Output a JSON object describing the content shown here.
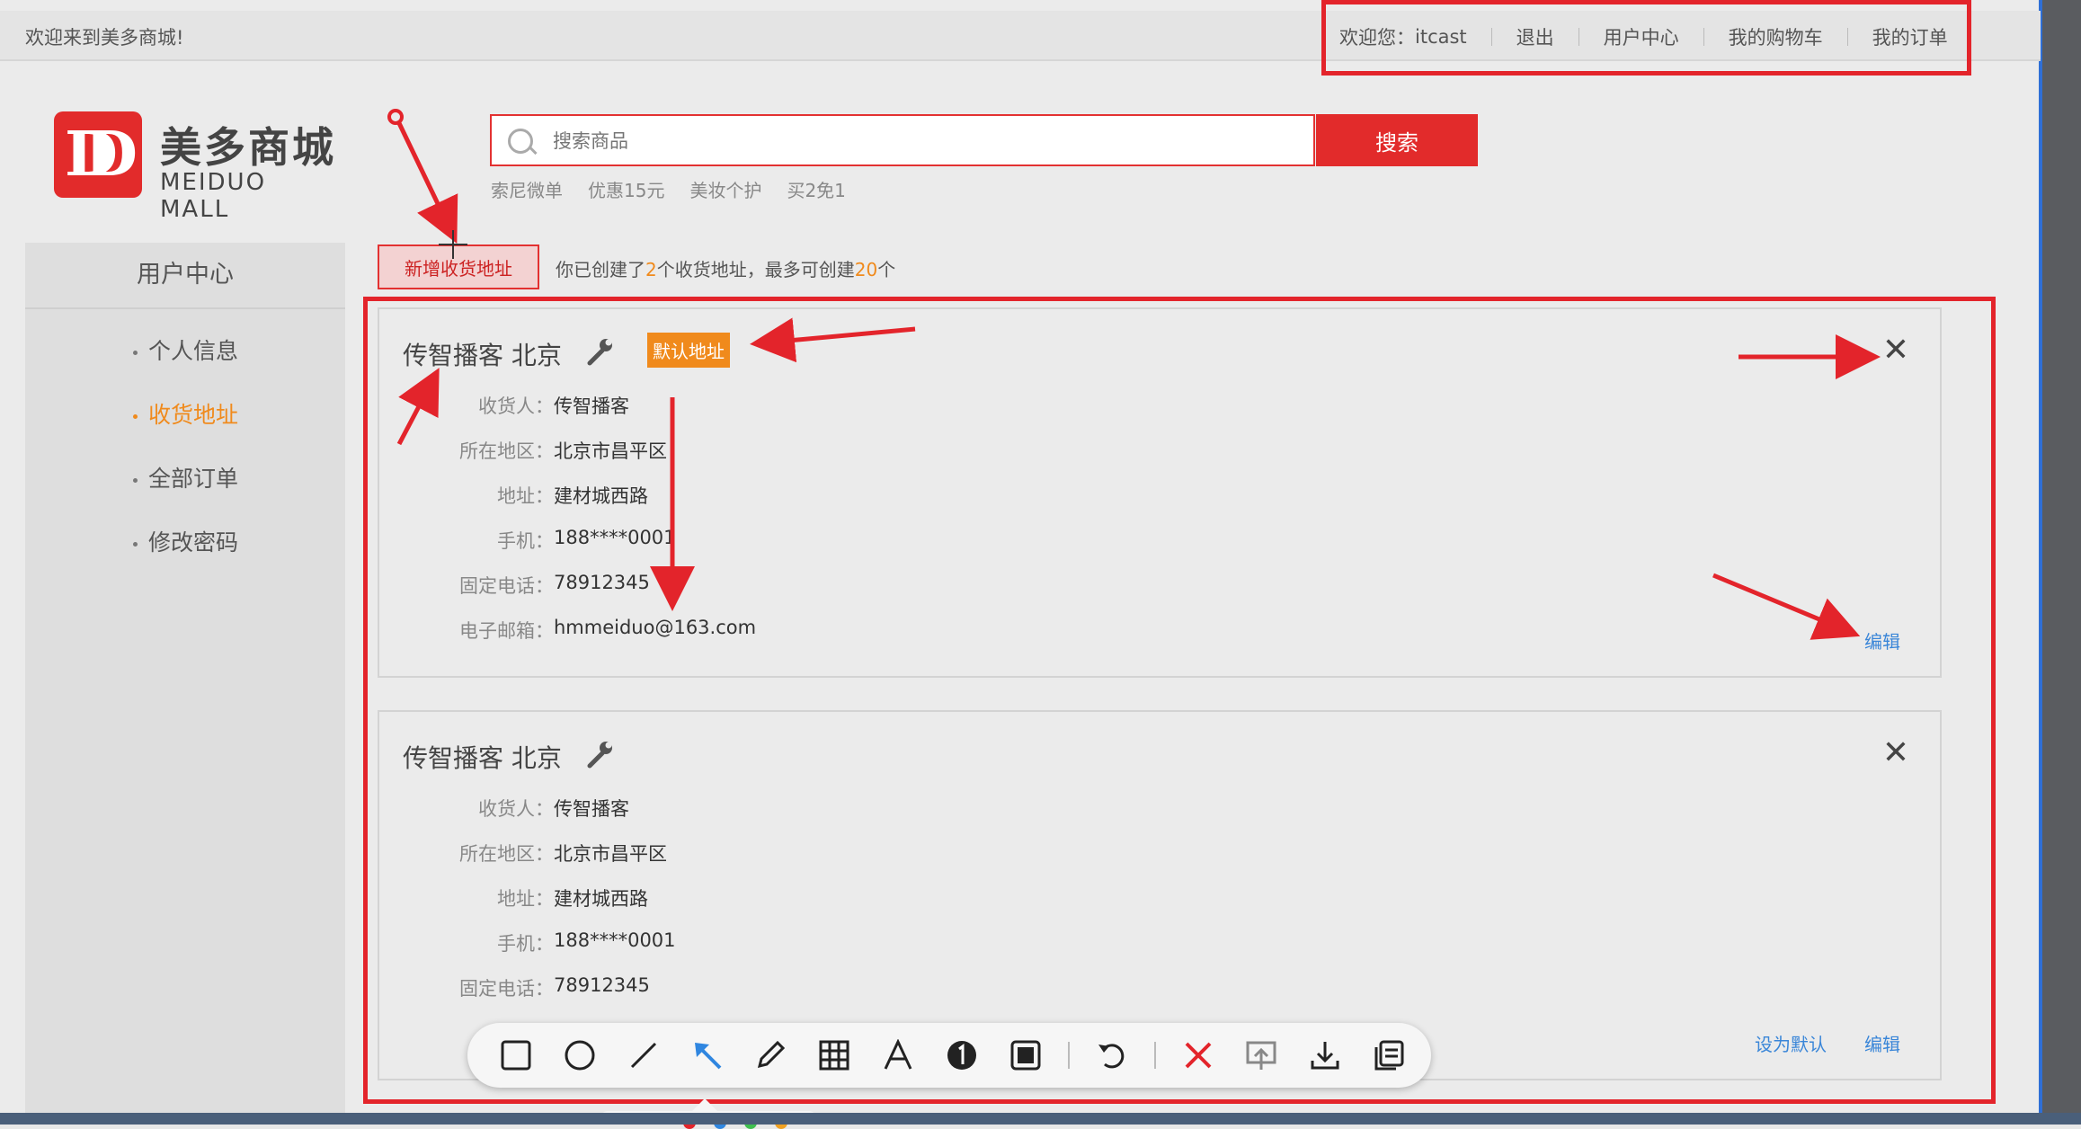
{
  "topbar": {
    "welcome": "欢迎来到美多商城!",
    "greeting": "欢迎您：",
    "username": "itcast",
    "logout": "退出",
    "user_center": "用户中心",
    "cart": "我的购物车",
    "orders": "我的订单"
  },
  "logo": {
    "cn": "美多商城",
    "en": "MEIDUO MALL"
  },
  "search": {
    "placeholder": "搜索商品",
    "button": "搜索",
    "hot_words": [
      "索尼微单",
      "优惠15元",
      "美妆个护",
      "买2免1"
    ]
  },
  "sidebar": {
    "title": "用户中心",
    "items": [
      {
        "label": "个人信息",
        "active": false
      },
      {
        "label": "收货地址",
        "active": true
      },
      {
        "label": "全部订单",
        "active": false
      },
      {
        "label": "修改密码",
        "active": false
      }
    ]
  },
  "content": {
    "add_button": "新增收货地址",
    "count_prefix": "你已创建了",
    "count_current": "2",
    "count_middle": "个收货地址，最多可创建",
    "count_max": "20",
    "count_suffix": "个"
  },
  "addresses": [
    {
      "title": "传智播客 北京",
      "badge": "默认地址",
      "fields": [
        {
          "label": "收货人：",
          "value": "传智播客"
        },
        {
          "label": "所在地区：",
          "value": "北京市昌平区"
        },
        {
          "label": "地址：",
          "value": "建材城西路"
        },
        {
          "label": "手机：",
          "value": "188****0001"
        },
        {
          "label": "固定电话：",
          "value": "78912345"
        },
        {
          "label": "电子邮箱：",
          "value": "hmmeiduo@163.com"
        }
      ],
      "edit": "编辑"
    },
    {
      "title": "传智播客 北京",
      "fields": [
        {
          "label": "收货人：",
          "value": "传智播客"
        },
        {
          "label": "所在地区：",
          "value": "北京市昌平区"
        },
        {
          "label": "地址：",
          "value": "建材城西路"
        },
        {
          "label": "手机：",
          "value": "188****0001"
        },
        {
          "label": "固定电话：",
          "value": "78912345"
        }
      ],
      "set_default": "设为默认",
      "edit": "编辑"
    }
  ],
  "annotation_color": "#e3242b",
  "accent_orange": "#f08a1c",
  "brand_red": "#e22b2b",
  "link_blue": "#3a86d8"
}
